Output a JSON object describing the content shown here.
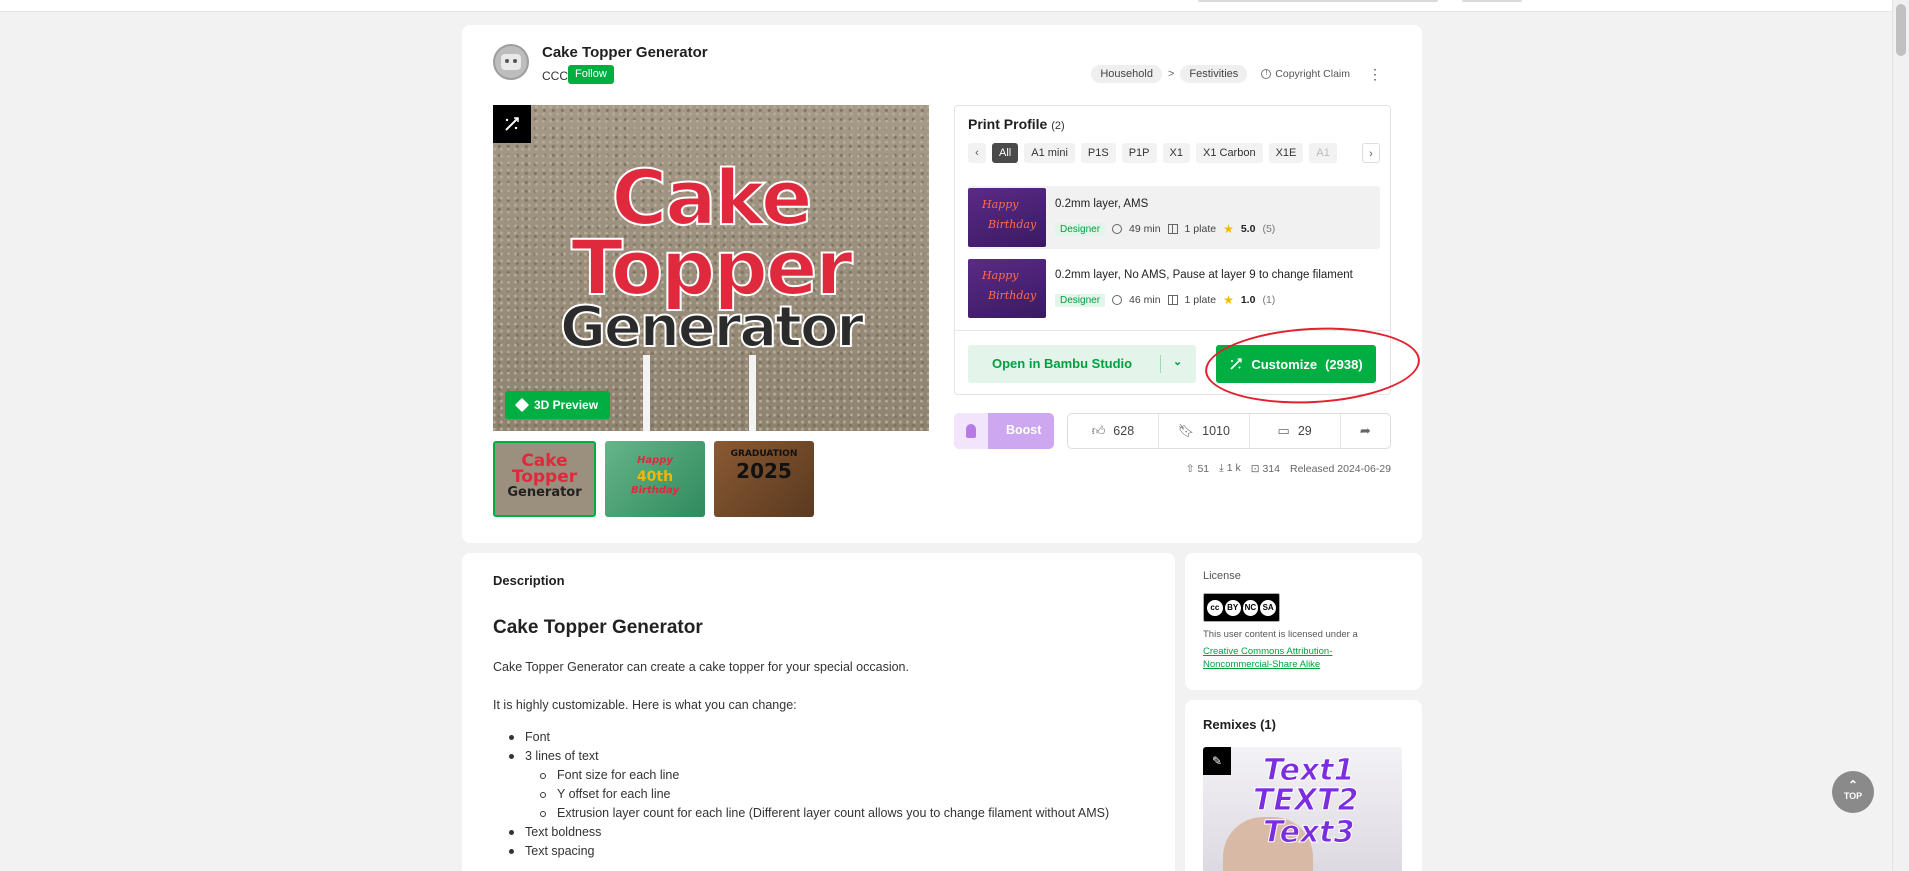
{
  "model": {
    "title": "Cake Topper Generator",
    "author": "CCC",
    "follow_label": "Follow",
    "breadcrumb": [
      "Household",
      "Festivities"
    ],
    "breadcrumb_sep": ">",
    "copyright_label": "Copyright Claim"
  },
  "gallery": {
    "main_text": [
      "Cake",
      "Topper",
      "Generator"
    ],
    "preview_label": "3D Preview",
    "thumb1": [
      "Cake",
      "Topper",
      "Generator"
    ],
    "thumb2": [
      "Happy",
      "40th",
      "Birthday"
    ],
    "thumb3": [
      "GRADUATION",
      "2025"
    ]
  },
  "print_profile": {
    "title": "Print Profile",
    "count": "(2)",
    "chips": [
      "All",
      "A1 mini",
      "P1S",
      "P1P",
      "X1",
      "X1 Carbon",
      "X1E",
      "A1"
    ],
    "profiles": [
      {
        "name": "0.2mm layer, AMS",
        "badge": "Designer",
        "time": "49 min",
        "plates": "1 plate",
        "rating": "5.0",
        "rating_count": "(5)",
        "thumb_text": [
          "Happy",
          "Birthday"
        ]
      },
      {
        "name": "0.2mm layer, No AMS, Pause at layer 9 to change filament",
        "badge": "Designer",
        "time": "46 min",
        "plates": "1 plate",
        "rating": "1.0",
        "rating_count": "(1)",
        "thumb_text": [
          "Happy",
          "Birthday"
        ]
      }
    ],
    "open_label": "Open in Bambu Studio",
    "customize_label": "Customize",
    "customize_count": "(2938)"
  },
  "actions": {
    "boost_label": "Boost",
    "likes": "628",
    "collects": "1010",
    "comments": "29"
  },
  "footer_stats": {
    "boosts": "51",
    "downloads": "1 k",
    "prints": "314",
    "released": "Released 2024-06-29"
  },
  "description": {
    "heading": "Description",
    "title": "Cake Topper Generator",
    "p1": "Cake Topper Generator can create a cake topper for your special occasion.",
    "p2": "It is highly customizable. Here is what you can change:",
    "items": {
      "font": "Font",
      "lines": "3 lines of text",
      "sub1": "Font size for each line",
      "sub2": "Y offset for each line",
      "sub3": "Extrusion layer count for each line (Different layer count allows you to change filament without AMS)",
      "boldness": "Text boldness",
      "spacing": "Text spacing"
    }
  },
  "license": {
    "title": "License",
    "cc_labels": [
      "BY",
      "NC",
      "SA"
    ],
    "text": "This user content is licensed under a",
    "link": "Creative Commons Attribution-Noncommercial-Share Alike"
  },
  "remixes": {
    "title": "Remixes (1)",
    "image_text": [
      "Text1",
      "TEXT2",
      "Text3"
    ]
  },
  "back_to_top": "TOP",
  "colors": {
    "brand_green": "#00ae42",
    "annotation_red": "#e3202e",
    "boost_purple": "#cda8f0"
  }
}
